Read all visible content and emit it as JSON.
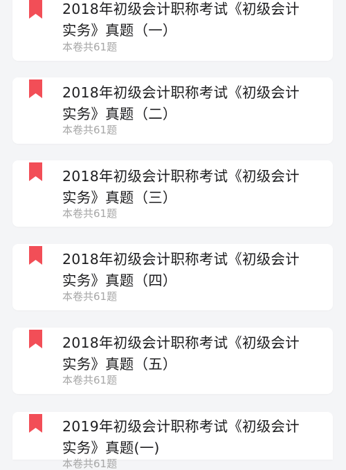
{
  "accent_color": "#f24e57",
  "papers": [
    {
      "title": "2018年初级会计职称考试《初级会计实务》真题（一）",
      "count": "本卷共61题"
    },
    {
      "title": "2018年初级会计职称考试《初级会计实务》真题（二）",
      "count": "本卷共61题"
    },
    {
      "title": "2018年初级会计职称考试《初级会计实务》真题（三）",
      "count": "本卷共61题"
    },
    {
      "title": "2018年初级会计职称考试《初级会计实务》真题（四）",
      "count": "本卷共61题"
    },
    {
      "title": "2018年初级会计职称考试《初级会计实务》真题（五）",
      "count": "本卷共61题"
    },
    {
      "title": "2019年初级会计职称考试《初级会计实务》真题(一)",
      "count": "本卷共61题"
    }
  ]
}
